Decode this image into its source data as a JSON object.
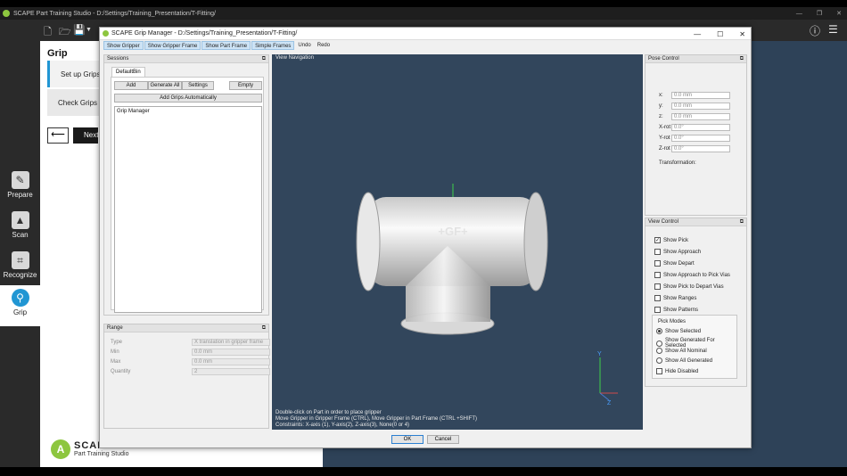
{
  "app": {
    "title": "SCAPE Part Training Studio - D:/Settings/Training_Presentation/T-Fitting/",
    "panel_title": "Grip",
    "step_setup": "Set up Grips",
    "step_check": "Check Grips",
    "back_symbol": "⟵",
    "next_label": "Next",
    "brand_name": "SCAPE",
    "brand_sub": "Part Training Studio",
    "rail": [
      {
        "label": "Prepare",
        "icon": "prepare-icon"
      },
      {
        "label": "Scan",
        "icon": "scan-icon"
      },
      {
        "label": "Recognize",
        "icon": "recognize-icon"
      },
      {
        "label": "Grip",
        "icon": "grip-icon"
      }
    ]
  },
  "dialog": {
    "title": "SCAPE Grip Manager - D:/Settings/Training_Presentation/T-Fitting/",
    "toolbar": [
      "Show Gripper",
      "Show Gripper Frame",
      "Show Part Frame",
      "Simple Frames",
      "Undo",
      "Redo"
    ],
    "sessions": {
      "header": "Sessions",
      "tab": "DefaultBin",
      "buttons": {
        "add": "Add",
        "generate_all": "Generate All",
        "settings": "Settings",
        "empty": "Empty",
        "add_auto": "Add Grips Automatically"
      },
      "list_item": "Grip Manager"
    },
    "range": {
      "header": "Range",
      "rows": [
        {
          "label": "Type",
          "value": "X translation in gripper frame"
        },
        {
          "label": "Min",
          "value": "0.0 mm"
        },
        {
          "label": "Max",
          "value": "0.0 mm"
        },
        {
          "label": "Quantity",
          "value": "2"
        }
      ]
    },
    "view": {
      "label": "View Navigation",
      "part_logo": "+GF+",
      "hint1": "Double-click on Part in order to place gripper",
      "hint2": "Move Gripper in Gripper Frame (CTRL), Move Gripper in Part Frame (CTRL +SHIFT)",
      "hint3": "Constraints: X-axis (1), Y-axis(2), Z-axis(3), None(0 or 4)",
      "axis_y": "Y",
      "axis_z": "Z"
    },
    "pose": {
      "header": "Pose Control",
      "rows": [
        {
          "label": "x:",
          "value": "0.0 mm"
        },
        {
          "label": "y:",
          "value": "0.0 mm"
        },
        {
          "label": "z:",
          "value": "0.0 mm"
        },
        {
          "label": "X-rot",
          "value": "0.0°"
        },
        {
          "label": "Y-rot",
          "value": "0.0°"
        },
        {
          "label": "Z-rot",
          "value": "0.0°"
        }
      ],
      "transformation": "Transformation:"
    },
    "view_control": {
      "header": "View Control",
      "checks": [
        {
          "label": "Show Pick",
          "checked": true
        },
        {
          "label": "Show Approach",
          "checked": false
        },
        {
          "label": "Show Depart",
          "checked": false
        },
        {
          "label": "Show Approach to Pick Vias",
          "checked": false
        },
        {
          "label": "Show Pick to Depart Vias",
          "checked": false
        },
        {
          "label": "Show Ranges",
          "checked": false
        },
        {
          "label": "Show Patterns",
          "checked": false
        }
      ],
      "pick_modes_title": "Pick Modes",
      "pick_modes": [
        {
          "label": "Show Selected",
          "selected": true
        },
        {
          "label": "Show Generated For Selected",
          "selected": false
        },
        {
          "label": "Show All Nominal",
          "selected": false
        },
        {
          "label": "Show All Generated",
          "selected": false
        }
      ],
      "hide_disabled": "Hide Disabled"
    },
    "ok": "OK",
    "cancel": "Cancel"
  },
  "colors": {
    "accent": "#2196d3",
    "brand_green": "#8dc63f",
    "viewport": "#32465c"
  }
}
